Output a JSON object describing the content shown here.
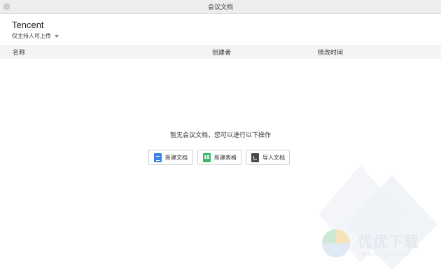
{
  "window": {
    "title": "会议文档"
  },
  "header": {
    "org_name": "Tencent",
    "permission": "仅主持人可上传"
  },
  "table": {
    "columns": [
      "名称",
      "创建者",
      "修改时间"
    ]
  },
  "empty_state": {
    "message": "暂无会议文档，您可以进行以下操作",
    "actions": [
      {
        "label": "新建文档",
        "icon": "doc-icon",
        "color": "#3a85e6"
      },
      {
        "label": "新建表格",
        "icon": "sheet-icon",
        "color": "#36b86a"
      },
      {
        "label": "导入文档",
        "icon": "import-icon",
        "color": "#4a4a4a"
      }
    ]
  },
  "watermark": {
    "text": "优优下载",
    "url": "www.yyxt.com"
  }
}
